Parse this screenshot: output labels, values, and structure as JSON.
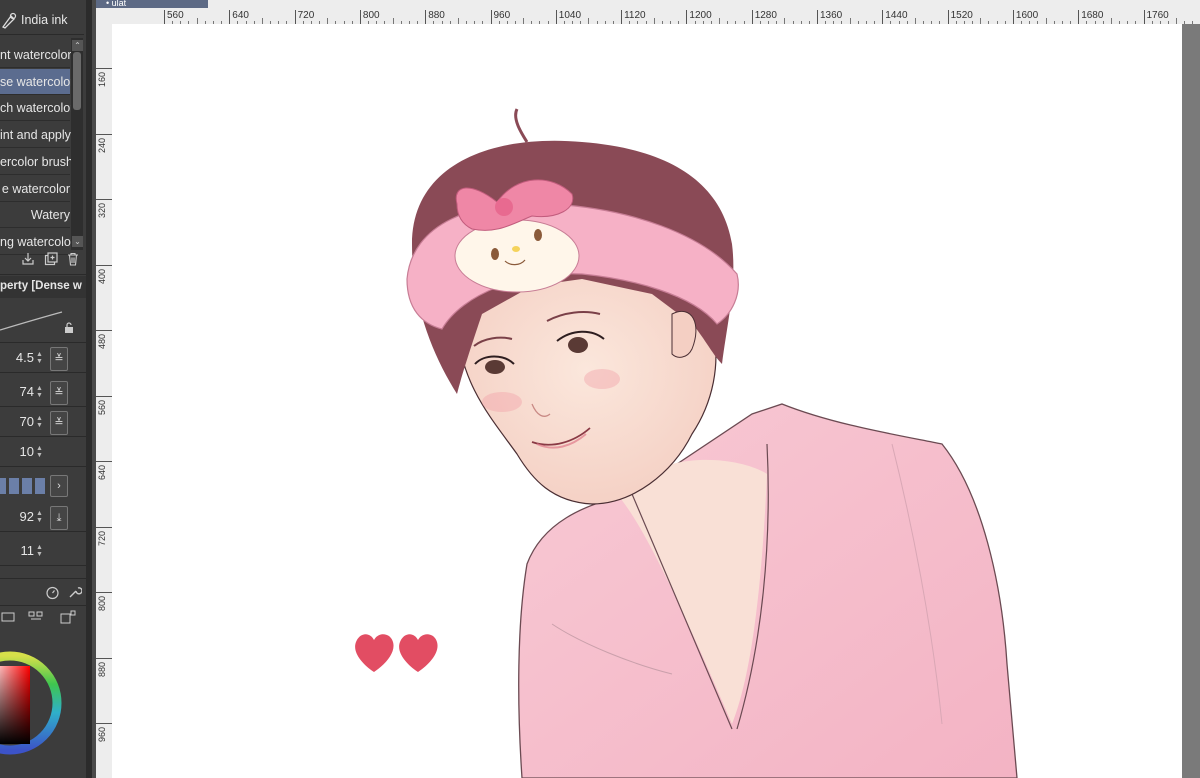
{
  "brush_header": {
    "label": "India ink",
    "icon": "pen-nib-icon"
  },
  "brush_list": [
    {
      "label": "nt watercolor",
      "selected": false
    },
    {
      "label": "se watercolor",
      "selected": true
    },
    {
      "label": "ch watercolor",
      "selected": false
    },
    {
      "label": "int and apply",
      "selected": false
    },
    {
      "label": "ercolor brush",
      "selected": false
    },
    {
      "label": "e watercolor",
      "selected": false
    },
    {
      "label": "Watery",
      "selected": false
    },
    {
      "label": "ng watercolor",
      "selected": false
    }
  ],
  "tool_property": {
    "title": "perty [Dense w"
  },
  "property_values": [
    {
      "value": "4.5",
      "button": "≚"
    },
    {
      "value": "74",
      "button": "≚"
    },
    {
      "value": "70",
      "button": "≚"
    },
    {
      "value": "10",
      "button": ""
    },
    {
      "value": "92",
      "button": "⤓"
    },
    {
      "value": "11",
      "button": ""
    }
  ],
  "ruler": {
    "top_ticks": [
      "560",
      "640",
      "720",
      "800",
      "880",
      "960",
      "1040",
      "1120",
      "1200",
      "1280",
      "1360",
      "1440",
      "1520",
      "1600",
      "1680",
      "1760"
    ],
    "left_ticks": [
      "160",
      "240",
      "320",
      "400",
      "480",
      "560",
      "640",
      "720",
      "800",
      "880",
      "960"
    ]
  },
  "doc_tab": {
    "label": "• ulat"
  },
  "colors": {
    "accent": "#5b6c8f",
    "panel": "#3c3c3c",
    "canvas": "#ffffff",
    "shirt": "#f6bccb",
    "heart": "#e24d63"
  }
}
